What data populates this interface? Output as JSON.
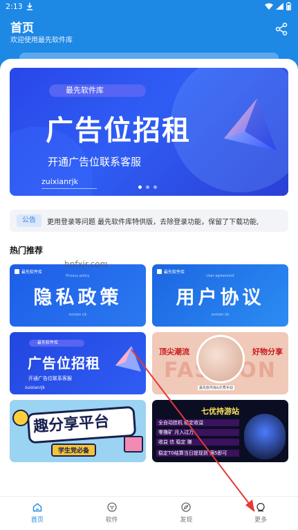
{
  "status": {
    "time": "2:13"
  },
  "header": {
    "title": "首页",
    "subtitle": "欢迎使用最先软件库"
  },
  "banner": {
    "pill": "最先软件库",
    "headline": "广告位招租",
    "sub": "开通广告位联系客服",
    "tag": "zuixianrjk",
    "dots": 3,
    "active_dot": 0
  },
  "notice": {
    "badge": "公告",
    "text": "更用登录等问题   最先软件库特供版，去除登录功能，保留了下载功能,"
  },
  "section": {
    "title": "热门推荐"
  },
  "watermark": "hnfxjr.com",
  "cards": {
    "privacy": {
      "brand": "最先软件库",
      "en": "Privacy policy",
      "title": "隐私政策",
      "foot": "zuixian rjk"
    },
    "agreement": {
      "brand": "最先软件库",
      "en": "User agreement",
      "title": "用户协议",
      "foot": "zuixian rjk"
    },
    "ad": {
      "pill": "最先软件库",
      "title": "广告位招租",
      "sub": "开通广告位联系客服",
      "tag": "zuixianrjk"
    },
    "fashion": {
      "left": "顶尖潮流",
      "right": "好物分享",
      "bg": "FASHION",
      "cap": "最先软件库&乐秀手动"
    },
    "share": {
      "title": "趣分享平台",
      "ribbon": "学生党必备"
    },
    "game": {
      "title": "七优持游站",
      "rows": [
        "全自动挂机 稳定收益",
        "零撸矿 月入过万",
        "收益 信 稳定 赚",
        "稳定T0结算当日提现到 满5即可"
      ]
    }
  },
  "tabs": [
    {
      "label": "首页",
      "icon": "home-icon",
      "active": true
    },
    {
      "label": "软件",
      "icon": "cube-icon",
      "active": false
    },
    {
      "label": "发现",
      "icon": "compass-icon",
      "active": false
    },
    {
      "label": "更多",
      "icon": "circle-icon",
      "active": false
    }
  ],
  "colors": {
    "primary": "#1e88e5",
    "arrow": "#e53935"
  }
}
